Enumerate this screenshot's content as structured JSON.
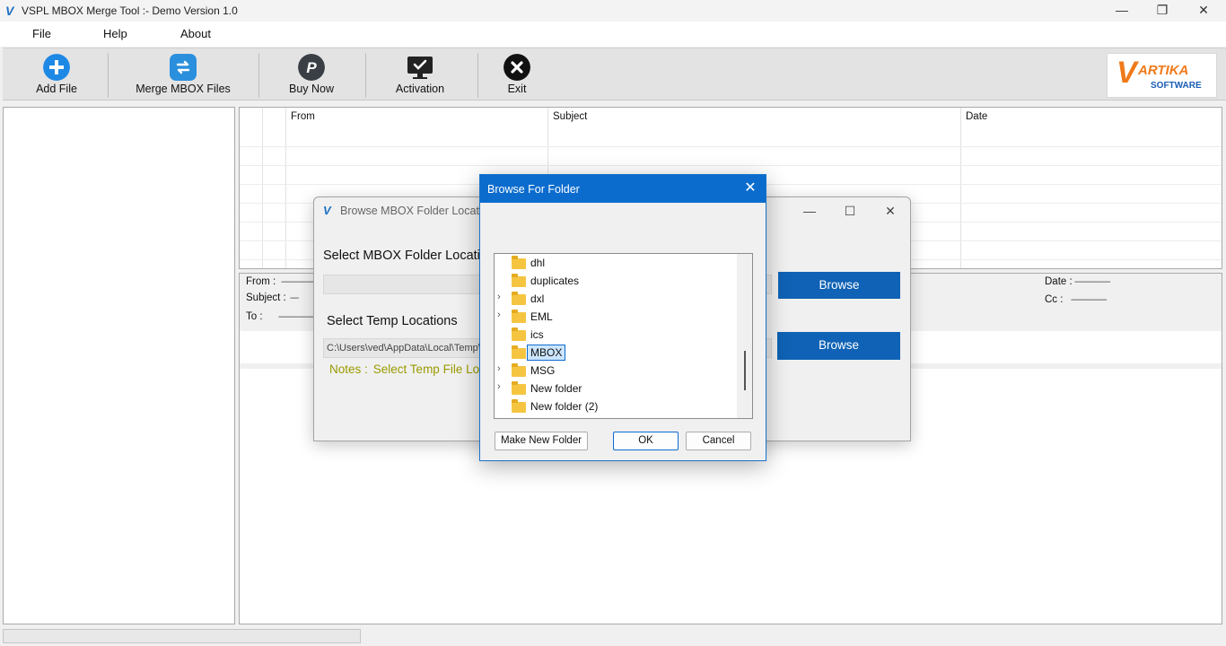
{
  "window": {
    "title": "VSPL MBOX Merge Tool  :- Demo Version 1.0",
    "logo_letter": "V",
    "min_glyph": "—",
    "max_glyph": "❐",
    "close_glyph": "✕"
  },
  "menu": [
    "File",
    "Help",
    "About"
  ],
  "toolbar": {
    "add_file": "Add File",
    "merge": "Merge MBOX Files",
    "buy_now": "Buy Now",
    "activation": "Activation",
    "exit": "Exit"
  },
  "brand": {
    "letter": "V",
    "name": "ARTIKA",
    "sub": "SOFTWARE"
  },
  "grid": {
    "columns": [
      "From",
      "Subject",
      "Date"
    ]
  },
  "preview": {
    "from_label": "From :",
    "subject_label": "Subject :",
    "subject_value": "----",
    "to_label": "To :",
    "date_label": "Date :",
    "cc_label": "Cc :",
    "dash": "-----------------"
  },
  "mbox_dialog": {
    "title": "Browse MBOX Folder Location",
    "select_label": "Select MBOX Folder Location",
    "browse": "Browse",
    "temp_label": "Select Temp Locations",
    "temp_path": "C:\\Users\\ved\\AppData\\Local\\Temp\\",
    "notes_key": "Notes :",
    "notes_text": "Select Temp File Location"
  },
  "folder_dialog": {
    "title": "Browse For Folder",
    "close_glyph": "✕",
    "folders": [
      {
        "name": "dhl",
        "expandable": false,
        "selected": false
      },
      {
        "name": "duplicates",
        "expandable": false,
        "selected": false
      },
      {
        "name": "dxl",
        "expandable": true,
        "selected": false
      },
      {
        "name": "EML",
        "expandable": true,
        "selected": false
      },
      {
        "name": "ics",
        "expandable": false,
        "selected": false
      },
      {
        "name": "MBOX",
        "expandable": false,
        "selected": true
      },
      {
        "name": "MSG",
        "expandable": true,
        "selected": false
      },
      {
        "name": "New folder",
        "expandable": true,
        "selected": false
      },
      {
        "name": "New folder (2)",
        "expandable": false,
        "selected": false
      }
    ],
    "make_new_folder": "Make New Folder",
    "ok": "OK",
    "cancel": "Cancel"
  },
  "colors": {
    "accent": "#0f62b5",
    "dialog_title": "#0b6cce",
    "notes": "#9a9a00"
  }
}
